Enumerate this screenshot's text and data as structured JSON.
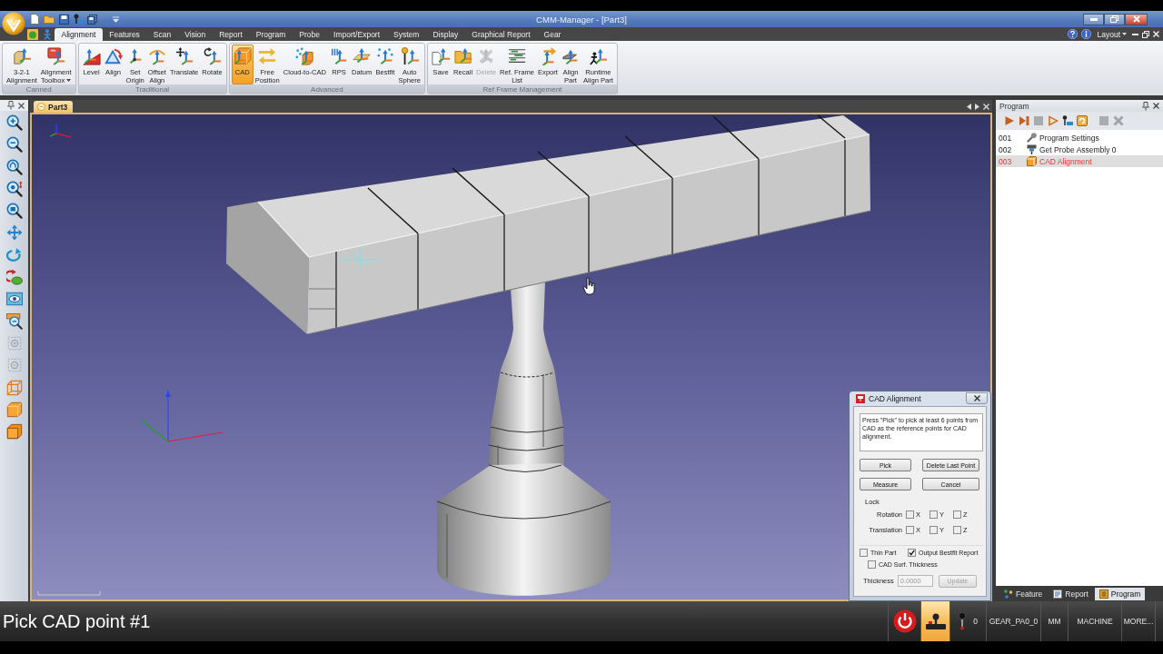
{
  "window": {
    "title": "CMM-Manager - [Part3]"
  },
  "ribbon": {
    "tabs": [
      {
        "label": "Alignment",
        "selected": true
      },
      {
        "label": "Features",
        "selected": false
      },
      {
        "label": "Scan",
        "selected": false
      },
      {
        "label": "Vision",
        "selected": false
      },
      {
        "label": "Report",
        "selected": false
      },
      {
        "label": "Program",
        "selected": false
      },
      {
        "label": "Probe",
        "selected": false
      },
      {
        "label": "Import/Export",
        "selected": false
      },
      {
        "label": "System",
        "selected": false
      },
      {
        "label": "Display",
        "selected": false
      },
      {
        "label": "Graphical Report",
        "selected": false
      },
      {
        "label": "Gear",
        "selected": false
      }
    ],
    "layout_menu": "Layout",
    "groups": [
      {
        "label": "Canned",
        "buttons": [
          {
            "label": "3-2-1\nAlignment",
            "selected": false,
            "disabled": false
          },
          {
            "label": "Alignment\nToolbox",
            "selected": false,
            "disabled": false,
            "dropdown": true
          }
        ]
      },
      {
        "label": "Traditional",
        "buttons": [
          {
            "label": "Level",
            "selected": false,
            "disabled": false
          },
          {
            "label": "Align",
            "selected": false,
            "disabled": false
          },
          {
            "label": "Set\nOrigin",
            "selected": false,
            "disabled": false
          },
          {
            "label": "Offset\nAlign",
            "selected": false,
            "disabled": false
          },
          {
            "label": "Translate",
            "selected": false,
            "disabled": false
          },
          {
            "label": "Rotate",
            "selected": false,
            "disabled": false
          }
        ]
      },
      {
        "label": "Advanced",
        "buttons": [
          {
            "label": "CAD",
            "selected": true,
            "disabled": false
          },
          {
            "label": "Free\nPosition",
            "selected": false,
            "disabled": false
          },
          {
            "label": "Cloud-to-CAD",
            "selected": false,
            "disabled": false
          },
          {
            "label": "RPS",
            "selected": false,
            "disabled": false
          },
          {
            "label": "Datum",
            "selected": false,
            "disabled": false
          },
          {
            "label": "Bestfit",
            "selected": false,
            "disabled": false
          },
          {
            "label": "Auto\nSphere",
            "selected": false,
            "disabled": false
          }
        ]
      },
      {
        "label": "Ref Frame Management",
        "buttons": [
          {
            "label": "Save",
            "selected": false,
            "disabled": false
          },
          {
            "label": "Recall",
            "selected": false,
            "disabled": false
          },
          {
            "label": "Delete",
            "selected": false,
            "disabled": true
          },
          {
            "label": "Ref. Frame\nList",
            "selected": false,
            "disabled": false
          },
          {
            "label": "Export",
            "selected": false,
            "disabled": false
          },
          {
            "label": "Align\nPart",
            "selected": false,
            "disabled": false
          },
          {
            "label": "Runtime\nAlign Part",
            "selected": false,
            "disabled": false
          }
        ]
      }
    ]
  },
  "view_toolbar": {
    "tools": [
      {
        "disabled": false
      },
      {
        "disabled": false
      },
      {
        "disabled": false
      },
      {
        "disabled": false
      },
      {
        "disabled": false
      },
      {
        "disabled": false
      },
      {
        "disabled": false
      },
      {
        "disabled": false
      },
      {
        "disabled": false
      },
      {
        "disabled": false
      },
      {
        "disabled": true
      },
      {
        "disabled": true
      },
      {
        "disabled": false
      },
      {
        "disabled": false
      },
      {
        "disabled": false
      }
    ]
  },
  "viewport": {
    "tab": "Part3"
  },
  "program_panel": {
    "title": "Program",
    "toolbar": [
      {
        "disabled": false
      },
      {
        "disabled": false
      },
      {
        "disabled": true
      },
      {
        "disabled": false
      },
      {
        "disabled": false
      },
      {
        "disabled": false
      },
      {
        "disabled": true
      },
      {
        "disabled": true
      }
    ],
    "steps": [
      {
        "number": "001",
        "label": "Program Settings",
        "selected": false
      },
      {
        "number": "002",
        "label": "Get Probe Assembly 0",
        "selected": false
      },
      {
        "number": "003",
        "label": "CAD Alignment",
        "selected": true
      }
    ],
    "tabs": [
      {
        "label": "Feature",
        "selected": false
      },
      {
        "label": "Report",
        "selected": false
      },
      {
        "label": "Program",
        "selected": true
      }
    ]
  },
  "dialog": {
    "title": "CAD Alignment",
    "message": "Press \"Pick\" to pick at least 6 points from CAD as the reference points for CAD alignment.",
    "buttons": [
      "Pick",
      "Delete Last Point",
      "Measure",
      "Cancel"
    ],
    "lock": {
      "label": "Lock",
      "rows": [
        {
          "label": "Rotation",
          "axes": [
            {
              "label": "X",
              "checked": false
            },
            {
              "label": "Y",
              "checked": false
            },
            {
              "label": "Z",
              "checked": false
            }
          ]
        },
        {
          "label": "Translation",
          "axes": [
            {
              "label": "X",
              "checked": false
            },
            {
              "label": "Y",
              "checked": false
            },
            {
              "label": "Z",
              "checked": false
            }
          ]
        }
      ]
    },
    "options": [
      {
        "label": "Thin Part",
        "checked": false
      },
      {
        "label": "Output Bestfit Report",
        "checked": true
      },
      {
        "label": "CAD Surf. Thickness",
        "checked": false
      }
    ],
    "thickness": {
      "label": "Thickness",
      "value": "0.0000",
      "disabled": true
    },
    "update_button": {
      "label": "Update",
      "disabled": true
    }
  },
  "status_bar": {
    "message": "Pick CAD point #1",
    "joystick": {
      "active": true
    },
    "probe_count": "0",
    "cells": [
      "GEAR_PA0_0",
      "MM",
      "MACHINE",
      "MORE..."
    ]
  }
}
